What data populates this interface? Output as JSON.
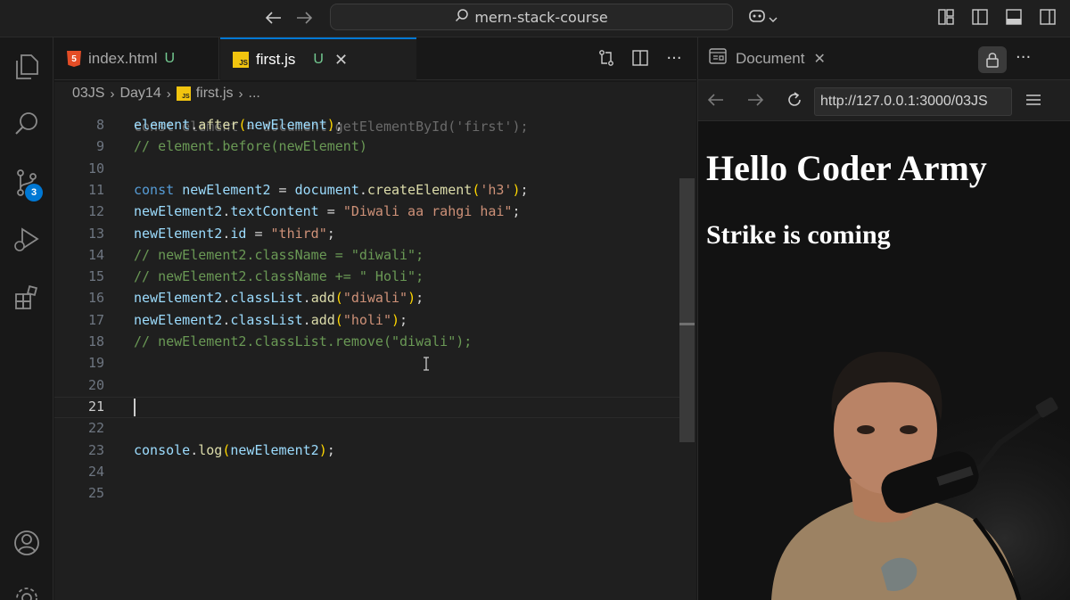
{
  "titlebar": {
    "search_text": "mern-stack-course",
    "back_icon": "arrow-left-icon",
    "forward_icon": "arrow-right-icon",
    "copilot_icon": "copilot-icon"
  },
  "activitybar": {
    "items": [
      "explorer-icon",
      "search-icon",
      "source-control-icon",
      "run-debug-icon",
      "extensions-icon",
      "account-icon",
      "settings-icon"
    ],
    "scm_badge": "3"
  },
  "tabs": [
    {
      "label": "index.html",
      "status": "U",
      "type": "html"
    },
    {
      "label": "first.js",
      "status": "U",
      "type": "js",
      "active": true
    }
  ],
  "breadcrumb": {
    "parts": [
      "03JS",
      "Day14",
      "first.js",
      "..."
    ]
  },
  "editor": {
    "lines": [
      {
        "n": "8",
        "tokens": [
          [
            "var",
            "element"
          ],
          [
            "pl",
            "."
          ],
          [
            "fn",
            "after"
          ],
          [
            "br1",
            "("
          ],
          [
            "var",
            "newElement"
          ],
          [
            "br1",
            ")"
          ],
          [
            "pl",
            ";"
          ]
        ]
      },
      {
        "n": "9",
        "tokens": [
          [
            "cm",
            "// element.before(newElement)"
          ]
        ]
      },
      {
        "n": "10",
        "tokens": []
      },
      {
        "n": "11",
        "tokens": [
          [
            "kw",
            "const "
          ],
          [
            "var",
            "newElement2"
          ],
          [
            "pl",
            " = "
          ],
          [
            "var",
            "document"
          ],
          [
            "pl",
            "."
          ],
          [
            "fn",
            "createElement"
          ],
          [
            "br1",
            "("
          ],
          [
            "str",
            "'h3'"
          ],
          [
            "br1",
            ")"
          ],
          [
            "pl",
            ";"
          ]
        ]
      },
      {
        "n": "12",
        "tokens": [
          [
            "var",
            "newElement2"
          ],
          [
            "pl",
            "."
          ],
          [
            "var",
            "textContent"
          ],
          [
            "pl",
            " = "
          ],
          [
            "str",
            "\"Diwali aa rahgi hai\""
          ],
          [
            "pl",
            ";"
          ]
        ]
      },
      {
        "n": "13",
        "tokens": [
          [
            "var",
            "newElement2"
          ],
          [
            "pl",
            "."
          ],
          [
            "var",
            "id"
          ],
          [
            "pl",
            " = "
          ],
          [
            "str",
            "\"third\""
          ],
          [
            "pl",
            ";"
          ]
        ]
      },
      {
        "n": "14",
        "tokens": [
          [
            "cm",
            "// newElement2.className = \"diwali\";"
          ]
        ]
      },
      {
        "n": "15",
        "tokens": [
          [
            "cm",
            "// newElement2.className += \" Holi\";"
          ]
        ]
      },
      {
        "n": "16",
        "tokens": [
          [
            "var",
            "newElement2"
          ],
          [
            "pl",
            "."
          ],
          [
            "var",
            "classList"
          ],
          [
            "pl",
            "."
          ],
          [
            "fn",
            "add"
          ],
          [
            "br1",
            "("
          ],
          [
            "str",
            "\"diwali\""
          ],
          [
            "br1",
            ")"
          ],
          [
            "pl",
            ";"
          ]
        ]
      },
      {
        "n": "17",
        "tokens": [
          [
            "var",
            "newElement2"
          ],
          [
            "pl",
            "."
          ],
          [
            "var",
            "classList"
          ],
          [
            "pl",
            "."
          ],
          [
            "fn",
            "add"
          ],
          [
            "br1",
            "("
          ],
          [
            "str",
            "\"holi\""
          ],
          [
            "br1",
            ")"
          ],
          [
            "pl",
            ";"
          ]
        ]
      },
      {
        "n": "18",
        "tokens": [
          [
            "cm",
            "// newElement2.classList.remove(\"diwali\");"
          ]
        ]
      },
      {
        "n": "19",
        "tokens": []
      },
      {
        "n": "20",
        "tokens": []
      },
      {
        "n": "21",
        "tokens": [],
        "current": true
      },
      {
        "n": "22",
        "tokens": []
      },
      {
        "n": "23",
        "tokens": [
          [
            "var",
            "console"
          ],
          [
            "pl",
            "."
          ],
          [
            "fn",
            "log"
          ],
          [
            "br1",
            "("
          ],
          [
            "var",
            "newElement2"
          ],
          [
            "br1",
            ")"
          ],
          [
            "pl",
            ";"
          ]
        ]
      },
      {
        "n": "24",
        "tokens": []
      },
      {
        "n": "25",
        "tokens": []
      }
    ],
    "partial_top_line": "const element = document.getElementById('first');"
  },
  "browser": {
    "tab_title": "Document",
    "url": "http://127.0.0.1:3000/03JS",
    "heading1": "Hello Coder Army",
    "heading2": "Strike is coming"
  }
}
